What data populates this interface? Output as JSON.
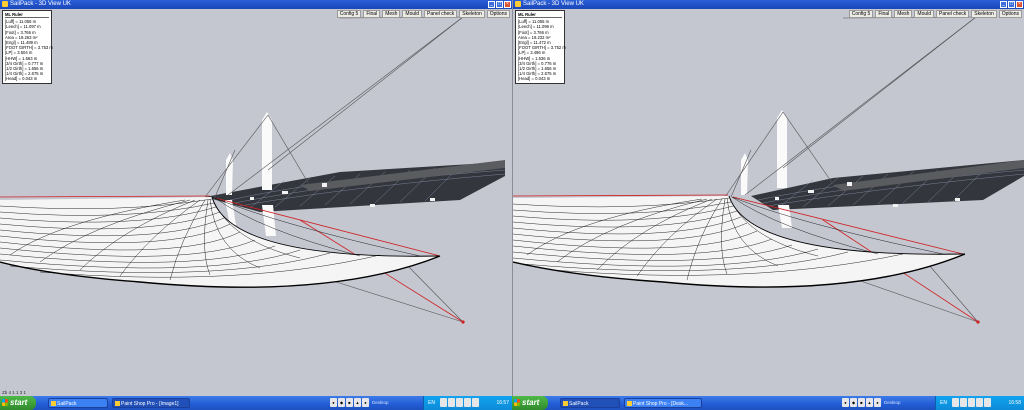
{
  "window_title": "SailPack - 3D View  UK",
  "menu": [
    "Config 5",
    "Final",
    "Mesh",
    "Mould",
    "Panel check",
    "Skeleton",
    "Options"
  ],
  "left_ruler": {
    "title": "ML Ruler",
    "rows": [
      "[Luff] = 11.056 m",
      "[Leech] = 11.097 m",
      "[Foot] = 3.766 m",
      "Area = 19.263 m²",
      "[Engl] = 11.489 m",
      "[FOOT GIRTH] = 3.753 m",
      "[LP] = 3.504 m",
      "[HHW] = 1.563 m",
      "[3/4 Girth] = 0.777 m",
      "[1/2 Girth] = 1.656 m",
      "[1/4 Girth] = 2.675 m",
      "[Head] = 0.043 m"
    ]
  },
  "right_ruler": {
    "title": "ML Ruler",
    "rows": [
      "[Luff] = 11.055 m",
      "[Leech] = 11.096 m",
      "[Foot] = 3.766 m",
      "Area = 19.232 m²",
      "[Engl] = 11.472 m",
      "[FOOT GIRTH] = 3.752 m",
      "[LP] = 3.496 m",
      "[HHW] = 1.536 m",
      "[3/4 Girth] = 0.776 m",
      "[1/2 Girth] = 1.656 m",
      "[1/4 Girth] = 2.675 m",
      "[Head] = 0.043 m"
    ]
  },
  "status_line": "Zb  4  1  1  3  1",
  "taskbar_left": {
    "start": "start",
    "tasks": [
      "SailPack",
      "Paint Shop Pro - [Image1]"
    ],
    "desktop_label": "Desktop",
    "lang": "EN",
    "clock": "16:57"
  },
  "taskbar_right": {
    "start": "start",
    "tasks": [
      "SailPack",
      "Paint Shop Pro - [Desk..."
    ],
    "desktop_label": "Desktop",
    "lang": "EN",
    "clock": "16:58"
  },
  "colors": {
    "viewport_bg": "#c4c6d0",
    "titlebar": "#2a5fd8",
    "red_line": "#d02020",
    "taskbar": "#225cd4",
    "start": "#3a9a35"
  }
}
